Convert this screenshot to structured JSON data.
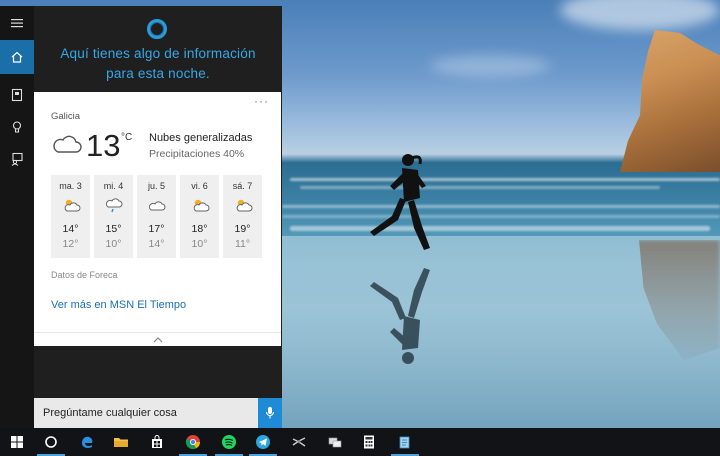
{
  "cortana": {
    "greeting_line1": "Aquí tienes algo de información",
    "greeting_line2": "para esta noche.",
    "search_placeholder": "Pregúntame cualquier cosa"
  },
  "rail": {
    "items": [
      {
        "name": "menu-icon"
      },
      {
        "name": "home-icon",
        "active": true
      },
      {
        "name": "notebook-icon"
      },
      {
        "name": "lightbulb-icon"
      },
      {
        "name": "feedback-icon"
      }
    ]
  },
  "weather": {
    "more_options": "···",
    "location": "Galicia",
    "temperature": "13",
    "unit": "°C",
    "condition": "Nubes generalizadas",
    "precipitation": "Precipitaciones 40%",
    "forecast": [
      {
        "day": "ma. 3",
        "icon": "partly-sunny-icon",
        "high": "14°",
        "low": "12°"
      },
      {
        "day": "mi. 4",
        "icon": "rain-icon",
        "high": "15°",
        "low": "10°"
      },
      {
        "day": "ju. 5",
        "icon": "cloudy-icon",
        "high": "17°",
        "low": "14°"
      },
      {
        "day": "vi. 6",
        "icon": "partly-sunny-icon",
        "high": "18°",
        "low": "10°"
      },
      {
        "day": "sá. 7",
        "icon": "partly-sunny-icon",
        "high": "19°",
        "low": "11°"
      }
    ],
    "source": "Datos de Foreca",
    "more_link": "Ver más en MSN El Tiempo"
  },
  "taskbar": {
    "items": [
      {
        "name": "start-button"
      },
      {
        "name": "cortana-button"
      },
      {
        "name": "edge-icon"
      },
      {
        "name": "file-explorer-icon"
      },
      {
        "name": "store-icon"
      },
      {
        "name": "chrome-icon"
      },
      {
        "name": "spotify-icon"
      },
      {
        "name": "telegram-icon"
      },
      {
        "name": "snipping-tool-icon"
      },
      {
        "name": "network-app-icon"
      },
      {
        "name": "calculator-icon"
      },
      {
        "name": "notepad-icon"
      }
    ]
  },
  "colors": {
    "accent": "#1f8ad6",
    "greeting": "#36a8e8",
    "link": "#1a6fb4"
  }
}
